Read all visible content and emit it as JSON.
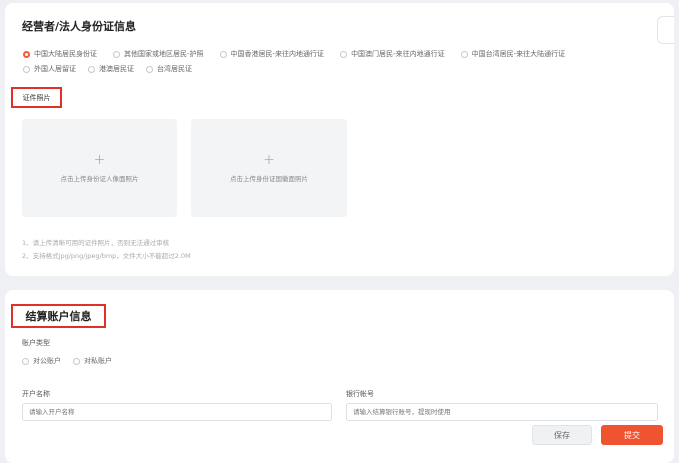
{
  "identity": {
    "title": "经营者/法人身份证信息",
    "id_types": [
      {
        "label": "中国大陆居民身份证",
        "selected": true
      },
      {
        "label": "其他国家或地区居民-护照",
        "selected": false
      },
      {
        "label": "中国香港居民-来往内地通行证",
        "selected": false
      },
      {
        "label": "中国澳门居民-来往内地通行证",
        "selected": false
      },
      {
        "label": "中国台湾居民-来往大陆通行证",
        "selected": false
      },
      {
        "label": "外国人居留证",
        "selected": false
      },
      {
        "label": "港澳居民证",
        "selected": false
      },
      {
        "label": "台湾居民证",
        "selected": false
      }
    ],
    "photo_label": "证件照片",
    "upload_front": {
      "plus": "+",
      "text": "点击上传身份证人像面照片"
    },
    "upload_back": {
      "plus": "+",
      "text": "点击上传身份证国徽面照片"
    },
    "notes": [
      "1、请上传清晰可用的证件照片，否则无法通过审核",
      "2、支持格式jpg/png/jpeg/bmp，文件大小不能超过2.0M"
    ]
  },
  "settlement": {
    "title": "结算账户信息",
    "account_type_label": "账户类型",
    "account_types": [
      {
        "label": "对公账户",
        "selected": false
      },
      {
        "label": "对私账户",
        "selected": false
      }
    ],
    "account_name_label": "开户名称",
    "account_name_placeholder": "请输入开户名称",
    "bank_account_label": "银行帐号",
    "bank_account_placeholder": "请输入结算银行账号，提现时使用"
  },
  "actions": {
    "save": "保存",
    "submit": "提交"
  },
  "colors": {
    "accent": "#f0532f",
    "highlight_border": "#e0302a"
  }
}
